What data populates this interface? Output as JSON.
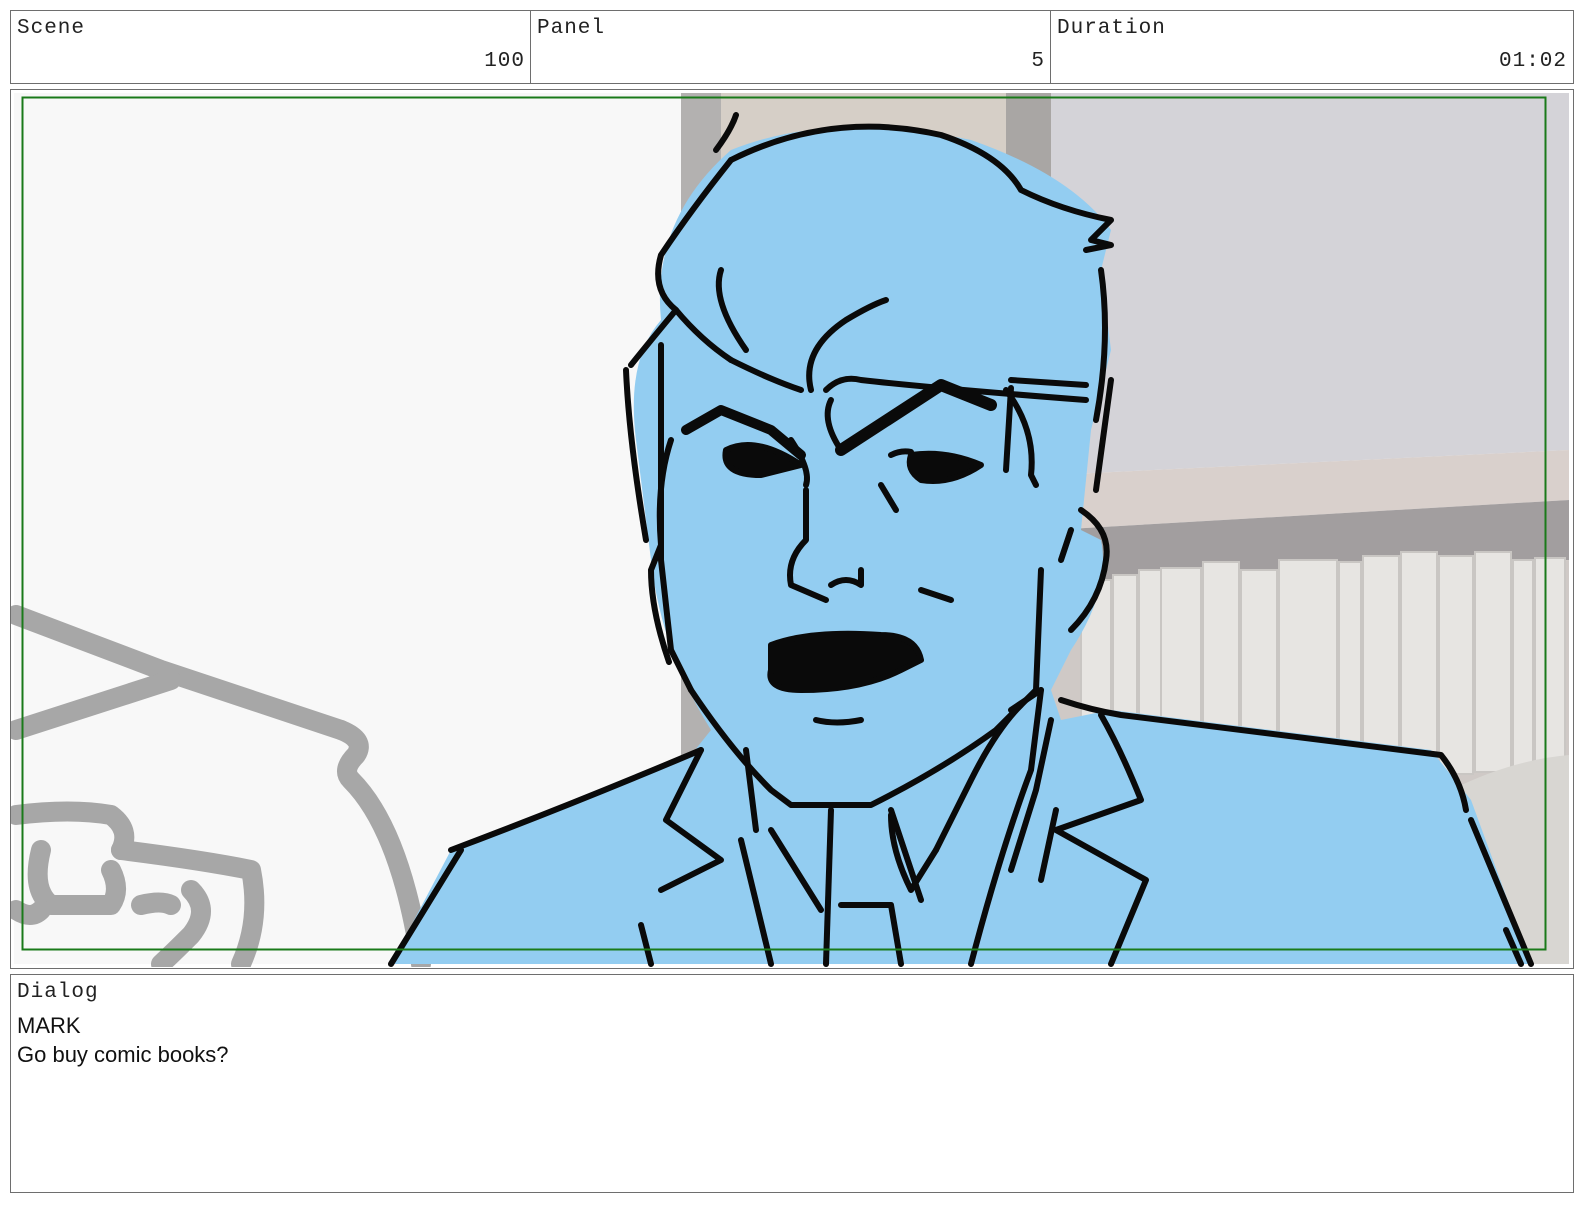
{
  "header": {
    "scene_label": "Scene",
    "scene_value": "100",
    "panel_label": "Panel",
    "panel_value": "5",
    "duration_label": "Duration",
    "duration_value": "01:02"
  },
  "dialog": {
    "label": "Dialog",
    "character": "MARK",
    "line": "Go buy comic books?"
  },
  "colors": {
    "frame_guide": "#1a7a1a",
    "character_fill": "#93cdf1",
    "background_wall": "#f8f8f8",
    "shelf": "#d8d6d8"
  }
}
